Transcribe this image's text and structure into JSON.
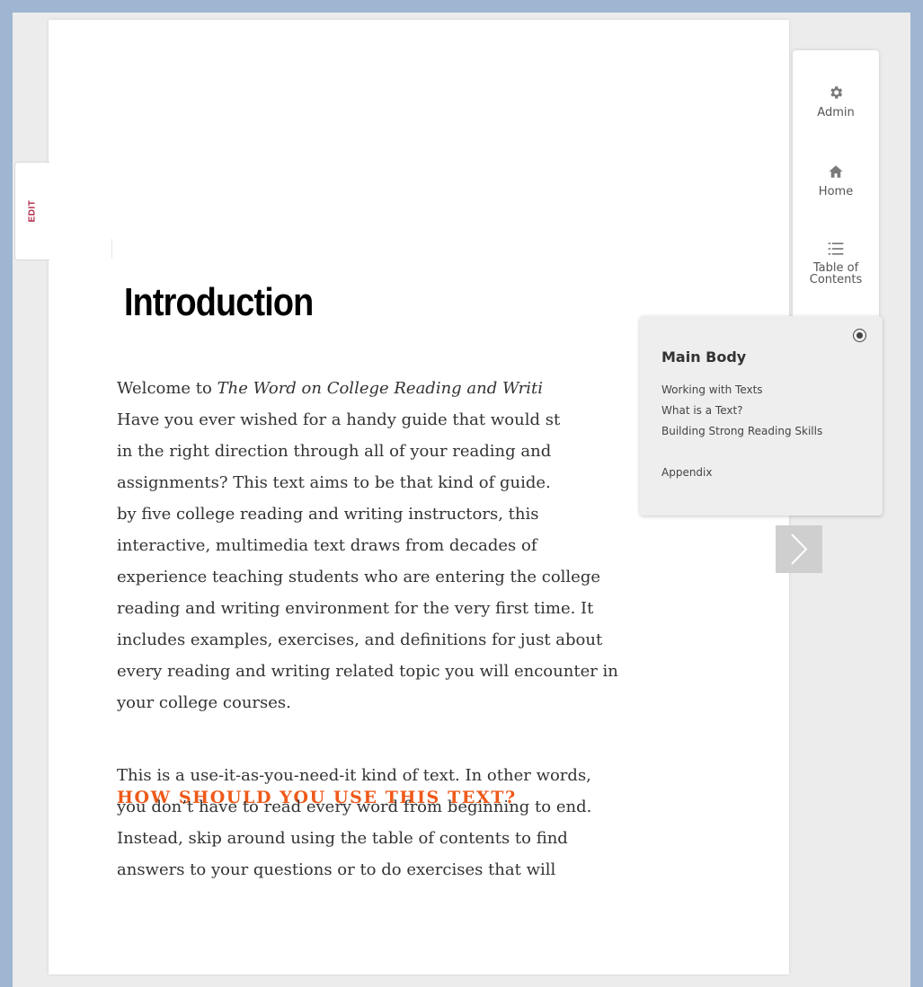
{
  "page": {
    "edit_label": "EDIT",
    "title": "Introduction",
    "intro_before_italic": "Welcome to ",
    "intro_italic": "The Word on College Reading and Writi",
    "intro_lines": [
      "Have you ever wished for a handy guide that would st",
      "in the right direction through all of your reading and",
      "assignments? This text aims to be that kind of guide.",
      "by five college reading and writing instructors, this",
      "interactive, multimedia text draws from decades of",
      "experience teaching students who are entering the college",
      "reading and writing environment for the very first time. It",
      "includes examples, exercises, and definitions for just about",
      "every reading and writing related topic you will encounter in",
      "your college courses."
    ],
    "section_heading": "HOW SHOULD YOU USE THIS TEXT?",
    "section_lines": [
      "This is a use-it-as-you-need-it kind of text. In other words,",
      "you don’t have to read every word from beginning to end.",
      "Instead, skip around using the table of contents to find",
      "answers to your questions or to do exercises that will"
    ]
  },
  "nav": {
    "admin_label": "Admin",
    "home_label": "Home",
    "toc_label_line1": "Table of",
    "toc_label_line2": "Contents"
  },
  "toc": {
    "heading": "Main Body",
    "items": [
      {
        "label": "Working with Texts"
      },
      {
        "label": "What is a Text?"
      },
      {
        "label": "Building Strong Reading Skills"
      },
      {
        "label": "Appendix"
      }
    ]
  },
  "icons": {
    "admin": "gear-icon",
    "home": "home-icon",
    "toc": "list-icon",
    "close": "close-icon",
    "next": "chevron-right-icon"
  },
  "colors": {
    "accent_heading": "#ee5a1a",
    "edit_text": "#b0294a",
    "body_text": "#333333"
  }
}
